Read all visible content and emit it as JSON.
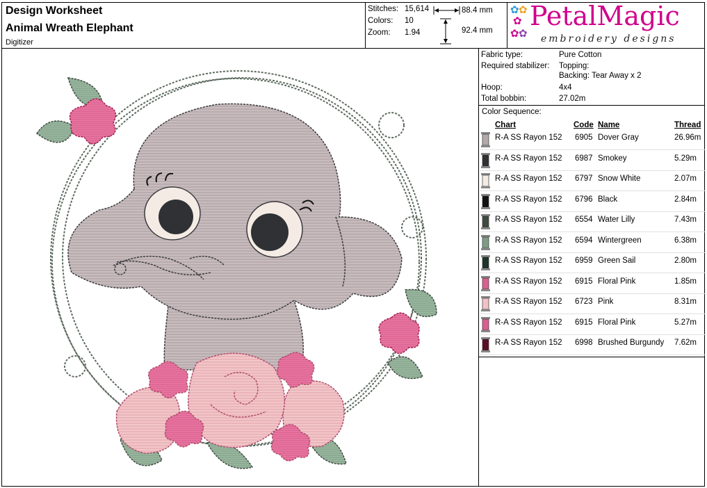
{
  "header": {
    "title": "Design Worksheet",
    "subtitle": "Animal Wreath Elephant",
    "digitizer_label": "Digitizer"
  },
  "stats": {
    "stitches_label": "Stitches:",
    "stitches_value": "15,614",
    "colors_label": "Colors:",
    "colors_value": "10",
    "zoom_label": "Zoom:",
    "zoom_value": "1.94",
    "width": "88.4 mm",
    "height": "92.4 mm"
  },
  "logo": {
    "brand": "PetalMagic",
    "tagline": "embroidery designs",
    "brand_color": "#d0008c"
  },
  "specs": {
    "fabric_label": "Fabric type:",
    "fabric_value": "Pure Cotton",
    "stabilizer_label": "Required stabilizer:",
    "topping_value": "Topping:",
    "backing_value": "Backing: Tear Away x 2",
    "hoop_label": "Hoop:",
    "hoop_value": "4x4",
    "bobbin_label": "Total bobbin:",
    "bobbin_value": "27.02m"
  },
  "color_sequence": {
    "title": "Color Sequence:",
    "headers": {
      "chart": "Chart",
      "code": "Code",
      "name": "Name",
      "thread": "Thread"
    },
    "rows": [
      {
        "chart": "R-A SS Rayon 152",
        "code": "6905",
        "name": "Dover Gray",
        "thread": "26.96m",
        "color": "#b3a9ab"
      },
      {
        "chart": "R-A SS Rayon 152",
        "code": "6987",
        "name": "Smokey",
        "thread": "5.29m",
        "color": "#2f3134"
      },
      {
        "chart": "R-A SS Rayon 152",
        "code": "6797",
        "name": "Snow White",
        "thread": "2.07m",
        "color": "#f4ece4"
      },
      {
        "chart": "R-A SS Rayon 152",
        "code": "6796",
        "name": "Black",
        "thread": "2.84m",
        "color": "#111111"
      },
      {
        "chart": "R-A SS Rayon 152",
        "code": "6554",
        "name": "Water Lilly",
        "thread": "7.43m",
        "color": "#3e4a40"
      },
      {
        "chart": "R-A SS Rayon 152",
        "code": "6594",
        "name": "Wintergreen",
        "thread": "6.38m",
        "color": "#7f9c85"
      },
      {
        "chart": "R-A SS Rayon 152",
        "code": "6959",
        "name": "Green Sail",
        "thread": "2.80m",
        "color": "#1e3428"
      },
      {
        "chart": "R-A SS Rayon 152",
        "code": "6915",
        "name": "Floral Pink",
        "thread": "1.85m",
        "color": "#d8608f"
      },
      {
        "chart": "R-A SS Rayon 152",
        "code": "6723",
        "name": "Pink",
        "thread": "8.31m",
        "color": "#f1c2c6"
      },
      {
        "chart": "R-A SS Rayon 152",
        "code": "6915",
        "name": "Floral Pink",
        "thread": "5.27m",
        "color": "#d8608f"
      },
      {
        "chart": "R-A SS Rayon 152",
        "code": "6998",
        "name": "Brushed Burgundy",
        "thread": "7.62m",
        "color": "#5a0f25"
      }
    ]
  }
}
